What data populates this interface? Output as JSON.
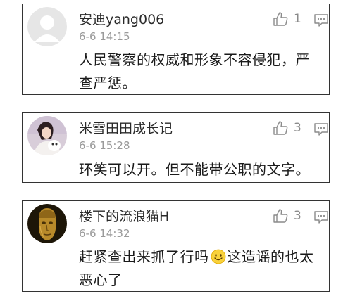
{
  "comments": [
    {
      "username": "安迪yang006",
      "timestamp": "6-6 14:15",
      "likes": "1",
      "avatar_icon": "default-user-silhouette",
      "text_before": "人民警察的权威和形象不容侵犯，严查严惩。",
      "text_after": ""
    },
    {
      "username": "米雪田田成长记",
      "timestamp": "6-6 15:28",
      "likes": "3",
      "avatar_icon": "photo-girl-with-white-dog",
      "text_before": "环笑可以开。但不能带公职的文字。",
      "text_after": ""
    },
    {
      "username": "楼下的流浪猫H",
      "timestamp": "6-6 14:32",
      "likes": "3",
      "avatar_icon": "golden-statue-head",
      "text_before": "赶紧查出来抓了行吗",
      "emoji": "smiley-face-emoji",
      "text_after": "这造谣的也太恶心了"
    }
  ],
  "icons": {
    "like": "thumbs-up-outline",
    "reply": "speech-bubble-outline"
  },
  "colors": {
    "username": "#2a2a2a",
    "timestamp": "#9a9a9a",
    "icon_gray": "#8a8a8a",
    "border": "#333333"
  }
}
